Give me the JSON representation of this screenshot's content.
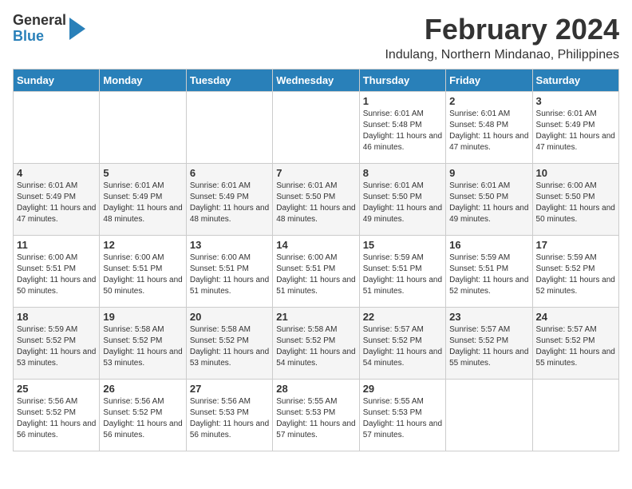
{
  "logo": {
    "general": "General",
    "blue": "Blue"
  },
  "title": {
    "month": "February 2024",
    "location": "Indulang, Northern Mindanao, Philippines"
  },
  "headers": [
    "Sunday",
    "Monday",
    "Tuesday",
    "Wednesday",
    "Thursday",
    "Friday",
    "Saturday"
  ],
  "weeks": [
    [
      {
        "day": "",
        "info": ""
      },
      {
        "day": "",
        "info": ""
      },
      {
        "day": "",
        "info": ""
      },
      {
        "day": "",
        "info": ""
      },
      {
        "day": "1",
        "info": "Sunrise: 6:01 AM\nSunset: 5:48 PM\nDaylight: 11 hours\nand 46 minutes."
      },
      {
        "day": "2",
        "info": "Sunrise: 6:01 AM\nSunset: 5:48 PM\nDaylight: 11 hours\nand 47 minutes."
      },
      {
        "day": "3",
        "info": "Sunrise: 6:01 AM\nSunset: 5:49 PM\nDaylight: 11 hours\nand 47 minutes."
      }
    ],
    [
      {
        "day": "4",
        "info": "Sunrise: 6:01 AM\nSunset: 5:49 PM\nDaylight: 11 hours\nand 47 minutes."
      },
      {
        "day": "5",
        "info": "Sunrise: 6:01 AM\nSunset: 5:49 PM\nDaylight: 11 hours\nand 48 minutes."
      },
      {
        "day": "6",
        "info": "Sunrise: 6:01 AM\nSunset: 5:49 PM\nDaylight: 11 hours\nand 48 minutes."
      },
      {
        "day": "7",
        "info": "Sunrise: 6:01 AM\nSunset: 5:50 PM\nDaylight: 11 hours\nand 48 minutes."
      },
      {
        "day": "8",
        "info": "Sunrise: 6:01 AM\nSunset: 5:50 PM\nDaylight: 11 hours\nand 49 minutes."
      },
      {
        "day": "9",
        "info": "Sunrise: 6:01 AM\nSunset: 5:50 PM\nDaylight: 11 hours\nand 49 minutes."
      },
      {
        "day": "10",
        "info": "Sunrise: 6:00 AM\nSunset: 5:50 PM\nDaylight: 11 hours\nand 50 minutes."
      }
    ],
    [
      {
        "day": "11",
        "info": "Sunrise: 6:00 AM\nSunset: 5:51 PM\nDaylight: 11 hours\nand 50 minutes."
      },
      {
        "day": "12",
        "info": "Sunrise: 6:00 AM\nSunset: 5:51 PM\nDaylight: 11 hours\nand 50 minutes."
      },
      {
        "day": "13",
        "info": "Sunrise: 6:00 AM\nSunset: 5:51 PM\nDaylight: 11 hours\nand 51 minutes."
      },
      {
        "day": "14",
        "info": "Sunrise: 6:00 AM\nSunset: 5:51 PM\nDaylight: 11 hours\nand 51 minutes."
      },
      {
        "day": "15",
        "info": "Sunrise: 5:59 AM\nSunset: 5:51 PM\nDaylight: 11 hours\nand 51 minutes."
      },
      {
        "day": "16",
        "info": "Sunrise: 5:59 AM\nSunset: 5:51 PM\nDaylight: 11 hours\nand 52 minutes."
      },
      {
        "day": "17",
        "info": "Sunrise: 5:59 AM\nSunset: 5:52 PM\nDaylight: 11 hours\nand 52 minutes."
      }
    ],
    [
      {
        "day": "18",
        "info": "Sunrise: 5:59 AM\nSunset: 5:52 PM\nDaylight: 11 hours\nand 53 minutes."
      },
      {
        "day": "19",
        "info": "Sunrise: 5:58 AM\nSunset: 5:52 PM\nDaylight: 11 hours\nand 53 minutes."
      },
      {
        "day": "20",
        "info": "Sunrise: 5:58 AM\nSunset: 5:52 PM\nDaylight: 11 hours\nand 53 minutes."
      },
      {
        "day": "21",
        "info": "Sunrise: 5:58 AM\nSunset: 5:52 PM\nDaylight: 11 hours\nand 54 minutes."
      },
      {
        "day": "22",
        "info": "Sunrise: 5:57 AM\nSunset: 5:52 PM\nDaylight: 11 hours\nand 54 minutes."
      },
      {
        "day": "23",
        "info": "Sunrise: 5:57 AM\nSunset: 5:52 PM\nDaylight: 11 hours\nand 55 minutes."
      },
      {
        "day": "24",
        "info": "Sunrise: 5:57 AM\nSunset: 5:52 PM\nDaylight: 11 hours\nand 55 minutes."
      }
    ],
    [
      {
        "day": "25",
        "info": "Sunrise: 5:56 AM\nSunset: 5:52 PM\nDaylight: 11 hours\nand 56 minutes."
      },
      {
        "day": "26",
        "info": "Sunrise: 5:56 AM\nSunset: 5:52 PM\nDaylight: 11 hours\nand 56 minutes."
      },
      {
        "day": "27",
        "info": "Sunrise: 5:56 AM\nSunset: 5:53 PM\nDaylight: 11 hours\nand 56 minutes."
      },
      {
        "day": "28",
        "info": "Sunrise: 5:55 AM\nSunset: 5:53 PM\nDaylight: 11 hours\nand 57 minutes."
      },
      {
        "day": "29",
        "info": "Sunrise: 5:55 AM\nSunset: 5:53 PM\nDaylight: 11 hours\nand 57 minutes."
      },
      {
        "day": "",
        "info": ""
      },
      {
        "day": "",
        "info": ""
      }
    ]
  ]
}
